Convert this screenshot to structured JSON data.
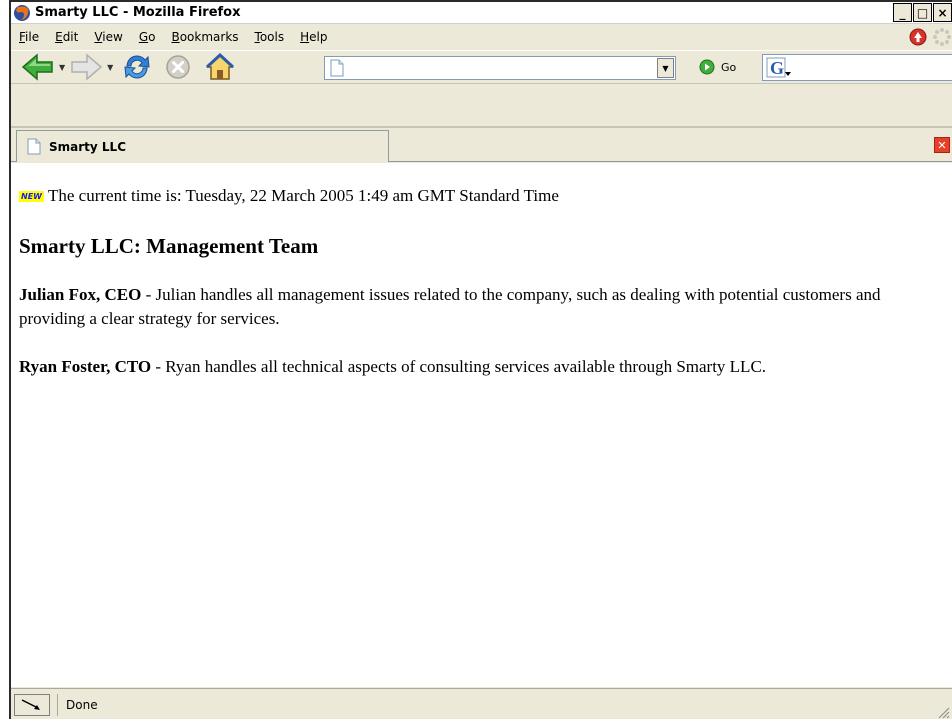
{
  "window": {
    "title": "Smarty LLC - Mozilla Firefox",
    "controls": {
      "minimize": "_",
      "maximize": "□",
      "close": "×"
    }
  },
  "menu": {
    "items": [
      {
        "label": "File",
        "accel": "F"
      },
      {
        "label": "Edit",
        "accel": "E"
      },
      {
        "label": "View",
        "accel": "V"
      },
      {
        "label": "Go",
        "accel": "G"
      },
      {
        "label": "Bookmarks",
        "accel": "B"
      },
      {
        "label": "Tools",
        "accel": "T"
      },
      {
        "label": "Help",
        "accel": "H"
      }
    ]
  },
  "toolbar": {
    "url_value": "",
    "go_label": "Go",
    "search_value": ""
  },
  "tabs": [
    {
      "label": "Smarty LLC",
      "active": true
    }
  ],
  "page": {
    "new_badge": "NEW",
    "time_text": "The current time is: Tuesday, 22 March 2005 1:49 am GMT Standard Time",
    "heading": "Smarty LLC: Management Team",
    "people": [
      {
        "name": "Julian Fox, CEO",
        "description": " - Julian handles all management issues related to the company, such as dealing with potential customers and providing a clear strategy for services."
      },
      {
        "name": "Ryan Foster, CTO",
        "description": " - Ryan handles all technical aspects of consulting services available through Smarty LLC."
      }
    ]
  },
  "status": {
    "text": "Done"
  },
  "colors": {
    "back_arrow": "#3fae3b",
    "forward_arrow": "#c8c8c8",
    "reload": "#2f7fd4",
    "tab_close": "#e6402b",
    "new_badge_bg": "#ffff00"
  },
  "icons": {
    "app": "firefox-icon",
    "back": "back-arrow-icon",
    "forward": "forward-arrow-icon",
    "reload": "reload-icon",
    "stop": "stop-icon",
    "home": "home-icon",
    "page": "page-icon",
    "go": "go-icon",
    "search_engine": "google-icon",
    "update": "update-notification-icon",
    "throbber": "throbber-icon",
    "status": "connection-status-icon"
  }
}
